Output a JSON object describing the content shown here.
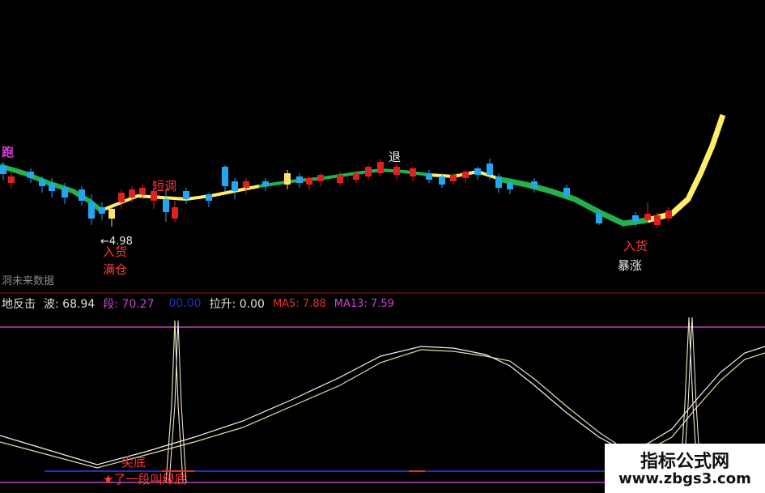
{
  "labels": {
    "top_left_cut": "跑",
    "duan_tiao": "短调",
    "tui": "退",
    "price_marker": "←4.98",
    "ru_huo_left": "入货",
    "man_cang": "满仓",
    "ru_huo_right": "入货",
    "bao_zhang": "暴涨",
    "future_data": "洞未来数据",
    "jian_di": "尖底",
    "star_line": "★了一段叫绿底"
  },
  "indicator": {
    "name": "地反击",
    "bo_label": "波: 68.94",
    "duan_label": "段: 70.27",
    "blue_value": "00.00",
    "la_sheng": "拉升: 0.00",
    "ma5": "MA5: 7.88",
    "ma13": "MA13: 7.59"
  },
  "watermark": {
    "site_name": "指标公式网",
    "url": "www.zbgs3.com"
  },
  "colors": {
    "up": "#e02020",
    "down": "#22a6f2",
    "ma_green": "#22b14c",
    "ma_yellow": "#ffee66",
    "line_white": "#f2f2f2",
    "line_tan": "#e8d9b0",
    "level_magenta": "#c040c0",
    "divider_red": "#b01010"
  }
}
